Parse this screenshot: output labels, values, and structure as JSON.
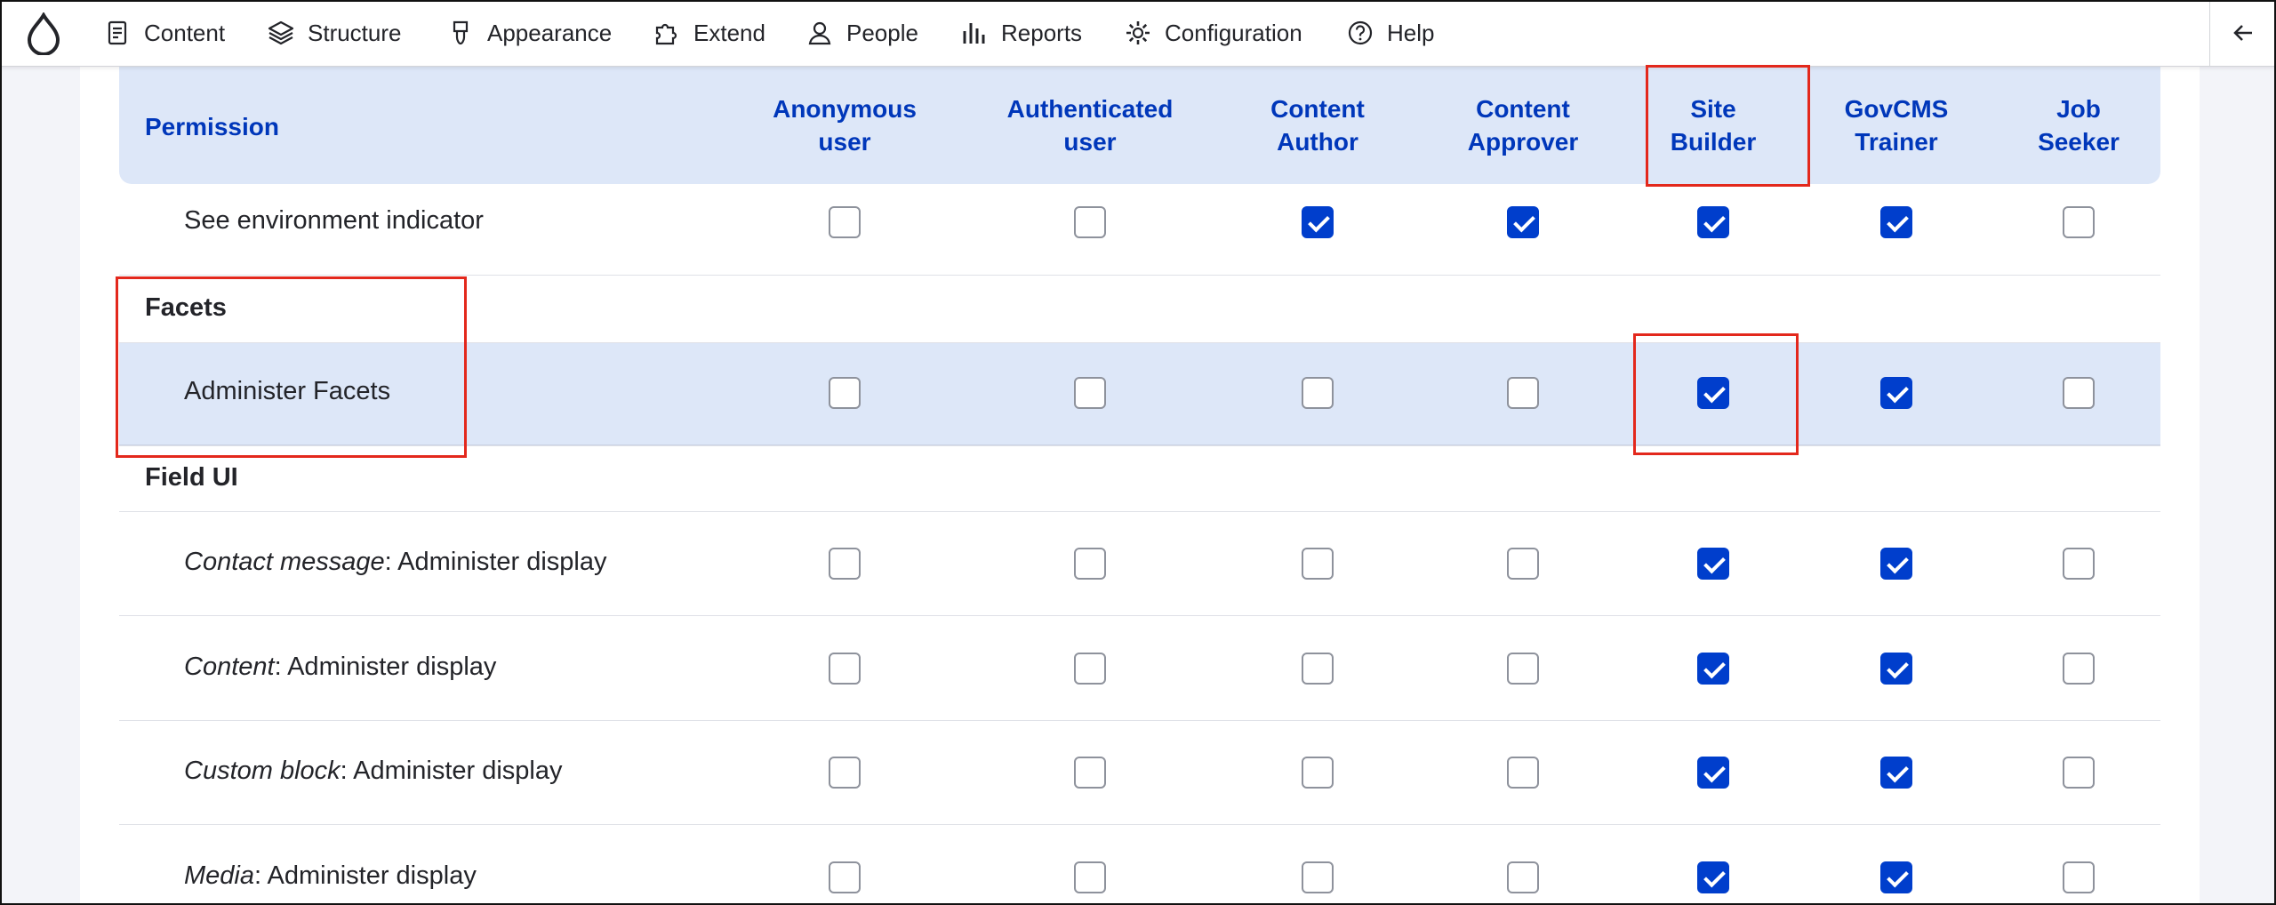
{
  "toolbar": {
    "items": [
      {
        "label": "Content",
        "icon": "document-icon"
      },
      {
        "label": "Structure",
        "icon": "layers-icon"
      },
      {
        "label": "Appearance",
        "icon": "brush-icon"
      },
      {
        "label": "Extend",
        "icon": "puzzle-icon"
      },
      {
        "label": "People",
        "icon": "person-icon"
      },
      {
        "label": "Reports",
        "icon": "bar-chart-icon"
      },
      {
        "label": "Configuration",
        "icon": "gear-icon"
      },
      {
        "label": "Help",
        "icon": "help-icon"
      }
    ],
    "collapse_icon": "arrow-left-icon"
  },
  "table": {
    "header": {
      "permission": "Permission",
      "roles": [
        {
          "line1": "Anonymous",
          "line2": "user"
        },
        {
          "line1": "Authenticated",
          "line2": "user"
        },
        {
          "line1": "Content",
          "line2": "Author"
        },
        {
          "line1": "Content",
          "line2": "Approver"
        },
        {
          "line1": "Site",
          "line2": "Builder"
        },
        {
          "line1": "GovCMS",
          "line2": "Trainer"
        },
        {
          "line1": "Job",
          "line2": "Seeker"
        }
      ]
    },
    "rows": [
      {
        "type": "perm",
        "em": "",
        "text": "See environment indicator",
        "checks": [
          false,
          false,
          true,
          true,
          true,
          true,
          false
        ]
      },
      {
        "type": "group",
        "text": "Facets"
      },
      {
        "type": "perm",
        "em": "",
        "text": "Administer Facets",
        "checks": [
          false,
          false,
          false,
          false,
          true,
          true,
          false
        ]
      },
      {
        "type": "group",
        "text": "Field UI"
      },
      {
        "type": "perm",
        "em": "Contact message",
        "text": ": Administer display",
        "checks": [
          false,
          false,
          false,
          false,
          true,
          true,
          false
        ]
      },
      {
        "type": "perm",
        "em": "Content",
        "text": ": Administer display",
        "checks": [
          false,
          false,
          false,
          false,
          true,
          true,
          false
        ]
      },
      {
        "type": "perm",
        "em": "Custom block",
        "text": ": Administer display",
        "checks": [
          false,
          false,
          false,
          false,
          true,
          true,
          false
        ]
      },
      {
        "type": "perm",
        "em": "Media",
        "text": ": Administer display",
        "checks": [
          false,
          false,
          false,
          false,
          true,
          true,
          false
        ]
      }
    ]
  },
  "colors": {
    "accent": "#003ecc",
    "header_bg": "#dde7f8",
    "highlight": "#e3281c"
  }
}
